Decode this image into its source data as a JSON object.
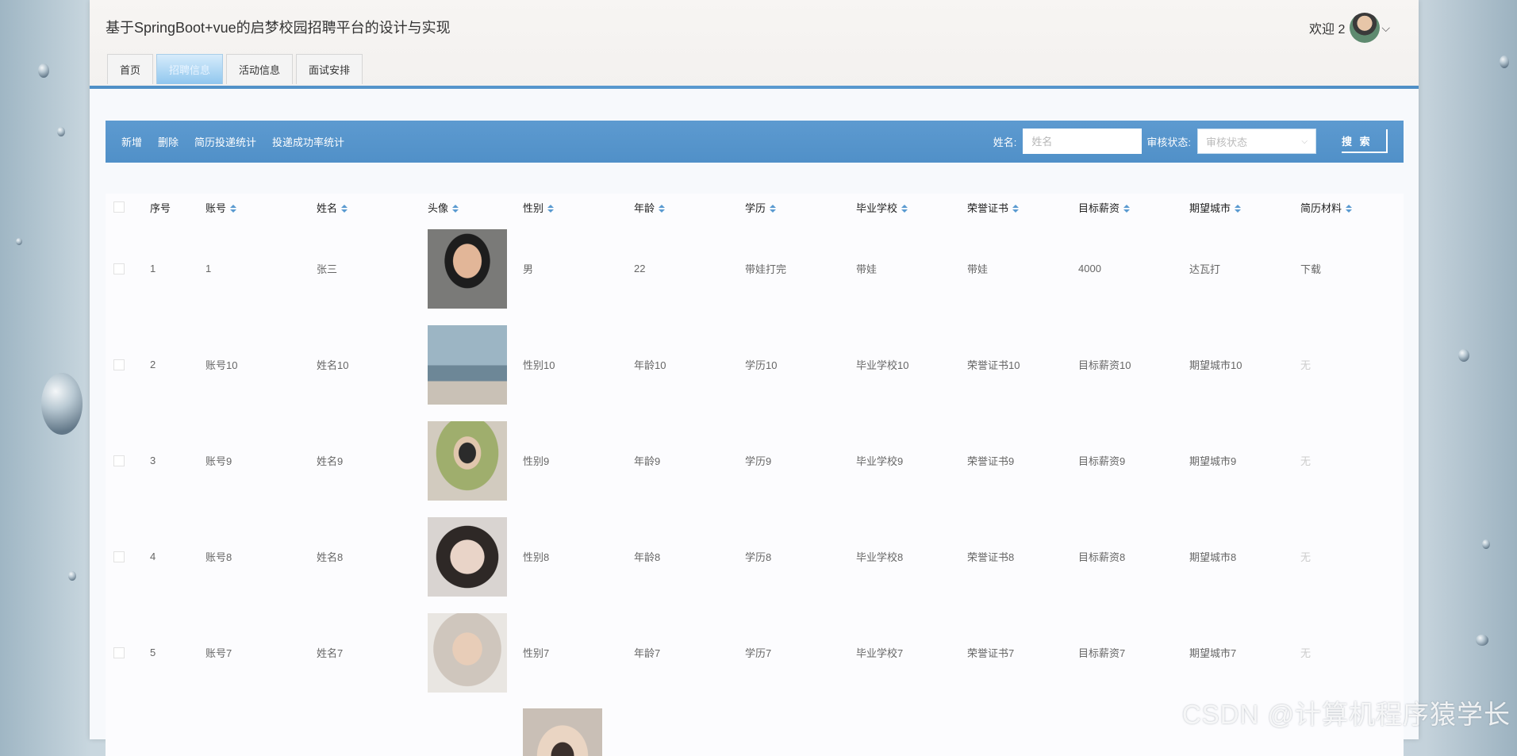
{
  "app": {
    "title": "基于SpringBoot+vue的启梦校园招聘平台的设计与实现"
  },
  "user": {
    "welcome": "欢迎 2"
  },
  "nav": {
    "tabs": [
      "首页",
      "招聘信息",
      "活动信息",
      "面试安排"
    ],
    "active": "招聘信息"
  },
  "toolbar": {
    "add": "新增",
    "delete": "删除",
    "resume_stats": "简历投递统计",
    "success_stats": "投递成功率统计",
    "name_label": "姓名:",
    "name_placeholder": "姓名",
    "status_label": "审核状态:",
    "status_placeholder": "审核状态",
    "search": "搜 索"
  },
  "table": {
    "headers": [
      "序号",
      "账号",
      "姓名",
      "头像",
      "性别",
      "年龄",
      "学历",
      "毕业学校",
      "荣誉证书",
      "目标薪资",
      "期望城市",
      "简历材料"
    ],
    "rows": [
      {
        "idx": "1",
        "account": "1",
        "name": "张三",
        "gender": "男",
        "age": "22",
        "edu": "带娃打完",
        "school": "带娃",
        "cert": "带娃",
        "salary": "4000",
        "city": "达瓦打",
        "resume": "下载"
      },
      {
        "idx": "2",
        "account": "账号10",
        "name": "姓名10",
        "gender": "性别10",
        "age": "年龄10",
        "edu": "学历10",
        "school": "毕业学校10",
        "cert": "荣誉证书10",
        "salary": "目标薪资10",
        "city": "期望城市10",
        "resume": "无"
      },
      {
        "idx": "3",
        "account": "账号9",
        "name": "姓名9",
        "gender": "性别9",
        "age": "年龄9",
        "edu": "学历9",
        "school": "毕业学校9",
        "cert": "荣誉证书9",
        "salary": "目标薪资9",
        "city": "期望城市9",
        "resume": "无"
      },
      {
        "idx": "4",
        "account": "账号8",
        "name": "姓名8",
        "gender": "性别8",
        "age": "年龄8",
        "edu": "学历8",
        "school": "毕业学校8",
        "cert": "荣誉证书8",
        "salary": "目标薪资8",
        "city": "期望城市8",
        "resume": "无"
      },
      {
        "idx": "5",
        "account": "账号7",
        "name": "姓名7",
        "gender": "性别7",
        "age": "年龄7",
        "edu": "学历7",
        "school": "毕业学校7",
        "cert": "荣誉证书7",
        "salary": "目标薪资7",
        "city": "期望城市7",
        "resume": "无"
      }
    ]
  },
  "watermark": "CSDN @计算机程序猿学长"
}
